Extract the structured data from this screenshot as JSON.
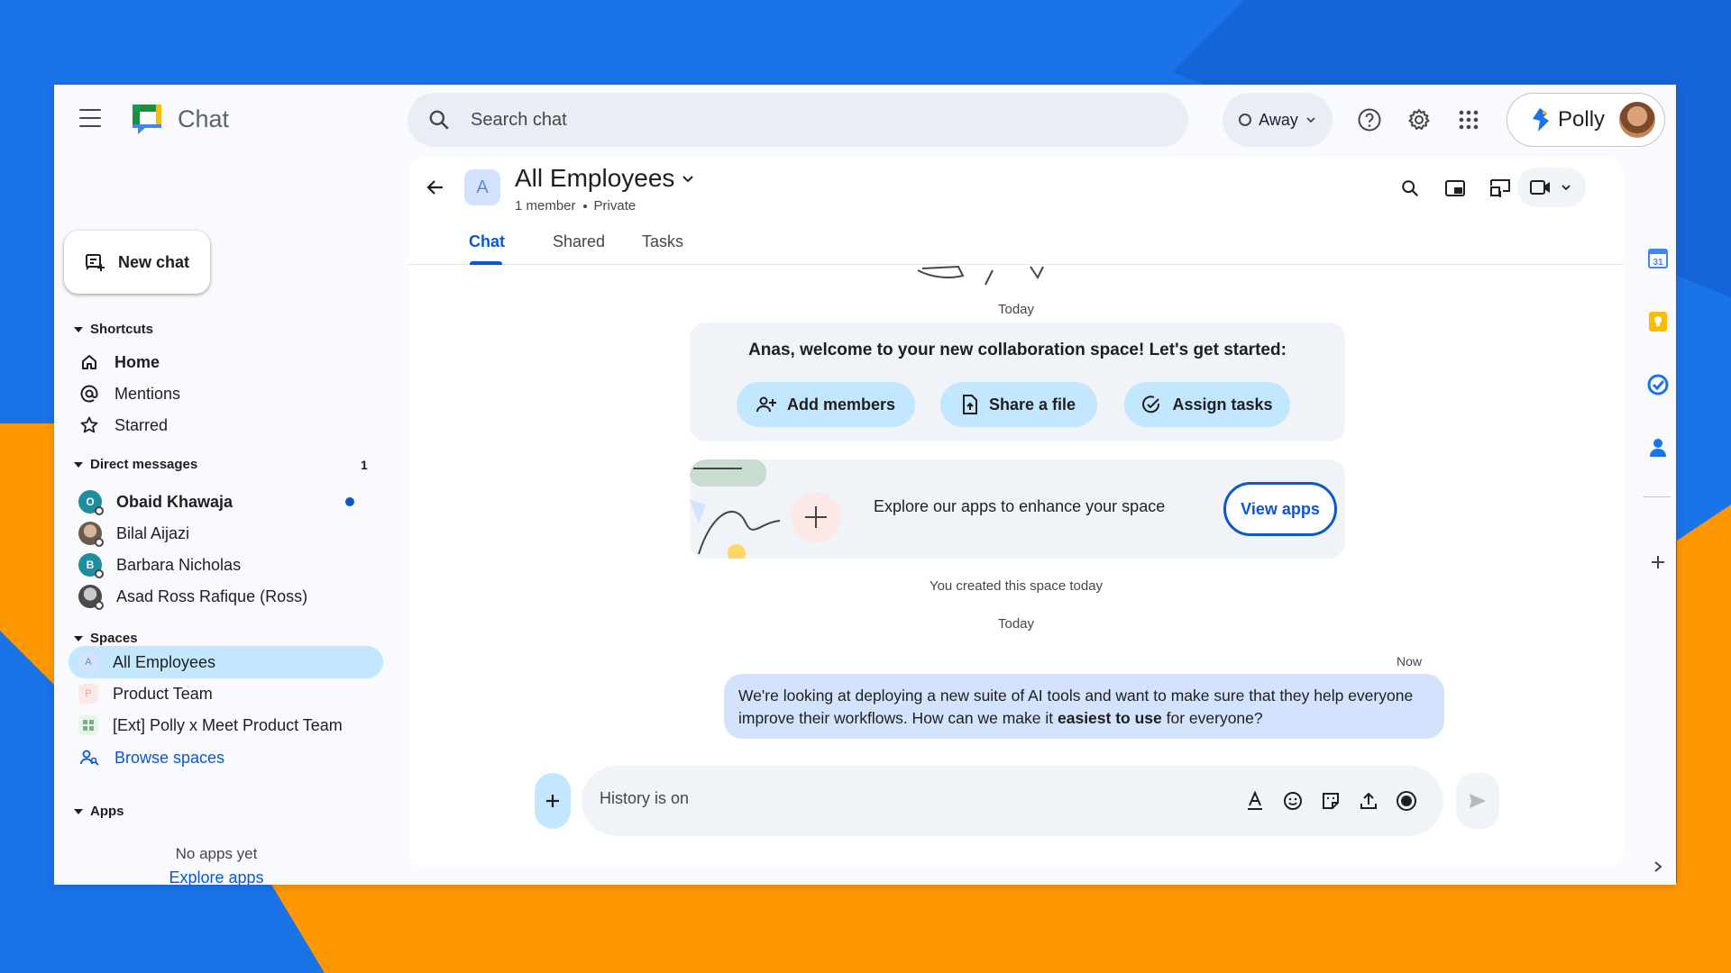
{
  "app": {
    "name": "Chat"
  },
  "search": {
    "placeholder": "Search chat"
  },
  "status": {
    "label": "Away"
  },
  "account": {
    "label": "Polly"
  },
  "sidebar": {
    "new_chat": "New chat",
    "shortcuts": {
      "heading": "Shortcuts",
      "items": [
        {
          "label": "Home",
          "icon": "home-icon"
        },
        {
          "label": "Mentions",
          "icon": "at-icon"
        },
        {
          "label": "Starred",
          "icon": "star-icon"
        }
      ]
    },
    "direct_messages": {
      "heading": "Direct messages",
      "count": "1",
      "items": [
        {
          "label": "Obaid Khawaja",
          "initial": "O",
          "unread": true
        },
        {
          "label": "Bilal Aijazi"
        },
        {
          "label": "Barbara Nicholas",
          "initial": "B"
        },
        {
          "label": "Asad Ross Rafique (Ross)"
        }
      ]
    },
    "spaces": {
      "heading": "Spaces",
      "items": [
        {
          "label": "All Employees",
          "chip": "A"
        },
        {
          "label": "Product Team",
          "chip": "P"
        },
        {
          "label": "[Ext] Polly x Meet Product Team"
        }
      ],
      "browse": "Browse spaces"
    },
    "apps": {
      "heading": "Apps",
      "empty": "No apps yet",
      "explore": "Explore apps"
    }
  },
  "space": {
    "chip": "A",
    "title": "All Employees",
    "members": "1 member",
    "visibility": "Private",
    "tabs": [
      "Chat",
      "Shared",
      "Tasks"
    ]
  },
  "conversation": {
    "day_label_1": "Today",
    "welcome_text": "Anas, welcome to your new collaboration space! Let's get started:",
    "actions": [
      "Add members",
      "Share a file",
      "Assign tasks"
    ],
    "apps_promo": "Explore our apps to enhance your space",
    "view_apps": "View apps",
    "created": "You created this space today",
    "day_label_2": "Today",
    "message_time": "Now",
    "message_part1": "We're looking at deploying a new suite of AI tools and want to make sure that they help everyone improve their workflows. How can we make it ",
    "message_bold": "easiest to use",
    "message_part2": " for everyone?"
  },
  "composer": {
    "placeholder": "History is on"
  },
  "colors": {
    "accent": "#0b57d0",
    "chip_bg": "#c2e7ff",
    "message_bg": "#d3e3fd",
    "bg_blue": "#1a73e8",
    "bg_orange": "#ff9800"
  }
}
